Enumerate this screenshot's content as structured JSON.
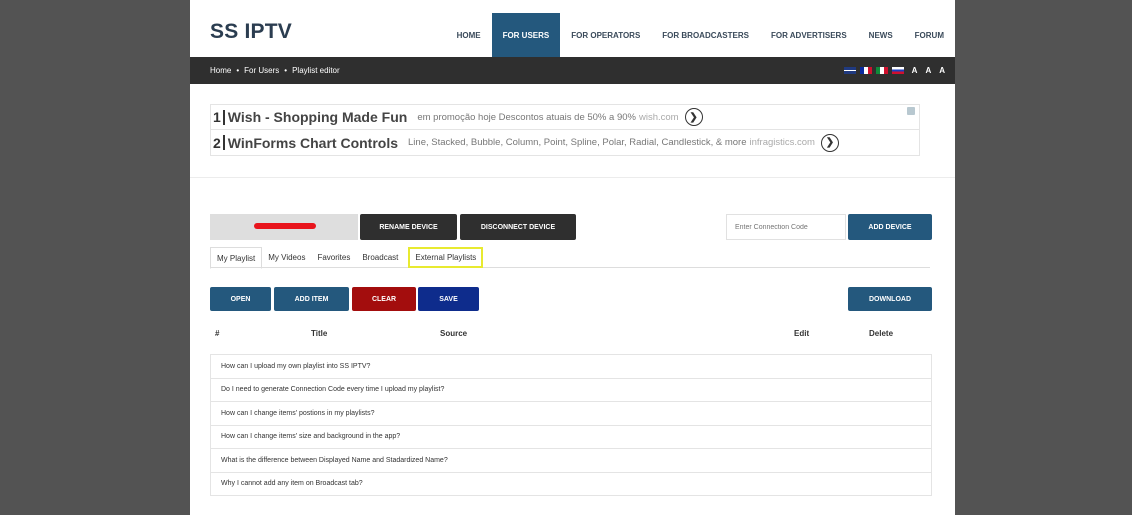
{
  "header": {
    "logo": "SS IPTV",
    "nav": [
      {
        "label": "HOME",
        "active": false
      },
      {
        "label": "FOR USERS",
        "active": true
      },
      {
        "label": "FOR OPERATORS",
        "active": false
      },
      {
        "label": "FOR BROADCASTERS",
        "active": false
      },
      {
        "label": "FOR ADVERTISERS",
        "active": false
      },
      {
        "label": "NEWS",
        "active": false
      },
      {
        "label": "FORUM",
        "active": false
      }
    ]
  },
  "breadcrumb": {
    "items": [
      "Home",
      "For Users",
      "Playlist editor"
    ],
    "separator": "•",
    "font_sizes": [
      "A",
      "A",
      "A"
    ],
    "languages": [
      "uk-flag-icon",
      "fr-flag-icon",
      "it-flag-icon",
      "ru-flag-icon"
    ]
  },
  "ads": [
    {
      "num": "1",
      "title": "Wish - Shopping Made Fun",
      "text": "em promoção hoje Descontos atuais de 50% a 90%",
      "domain": "wish.com",
      "arrow": "❯"
    },
    {
      "num": "2",
      "title": "WinForms Chart Controls",
      "text": "Line, Stacked, Bubble, Column, Point, Spline, Polar, Radial, Candlestick, & more",
      "domain": "infragistics.com",
      "arrow": "❯"
    }
  ],
  "device": {
    "rename_label": "RENAME DEVICE",
    "disconnect_label": "DISCONNECT DEVICE",
    "code_placeholder": "Enter Connection Code",
    "add_label": "ADD DEVICE"
  },
  "tabs": [
    {
      "label": "My Playlist",
      "active": true
    },
    {
      "label": "My Videos",
      "active": false
    },
    {
      "label": "Favorites",
      "active": false
    },
    {
      "label": "Broadcast",
      "active": false
    },
    {
      "label": "External Playlists",
      "active": false,
      "highlight": true
    }
  ],
  "toolbar": {
    "open": "OPEN",
    "add_item": "ADD ITEM",
    "clear": "CLEAR",
    "save": "SAVE",
    "download": "DOWNLOAD"
  },
  "table": {
    "headers": [
      "#",
      "Title",
      "Source",
      "Edit",
      "Delete"
    ]
  },
  "faq": [
    "How can I upload my own playlist into SS IPTV?",
    "Do I need to generate Connection Code every time I upload my playlist?",
    "How can I change items' postions in my playlists?",
    "How can I change items' size and background in the app?",
    "What is the difference between Displayed Name and Stadardized Name?",
    "Why I cannot add any item on Broadcast tab?"
  ],
  "colors": {
    "accent": "#24587d",
    "dark": "#2f2f2f",
    "clear": "#a30d0d",
    "save": "#0e2c8c",
    "highlight": "#e8ea30",
    "redaction": "#e8141c"
  }
}
